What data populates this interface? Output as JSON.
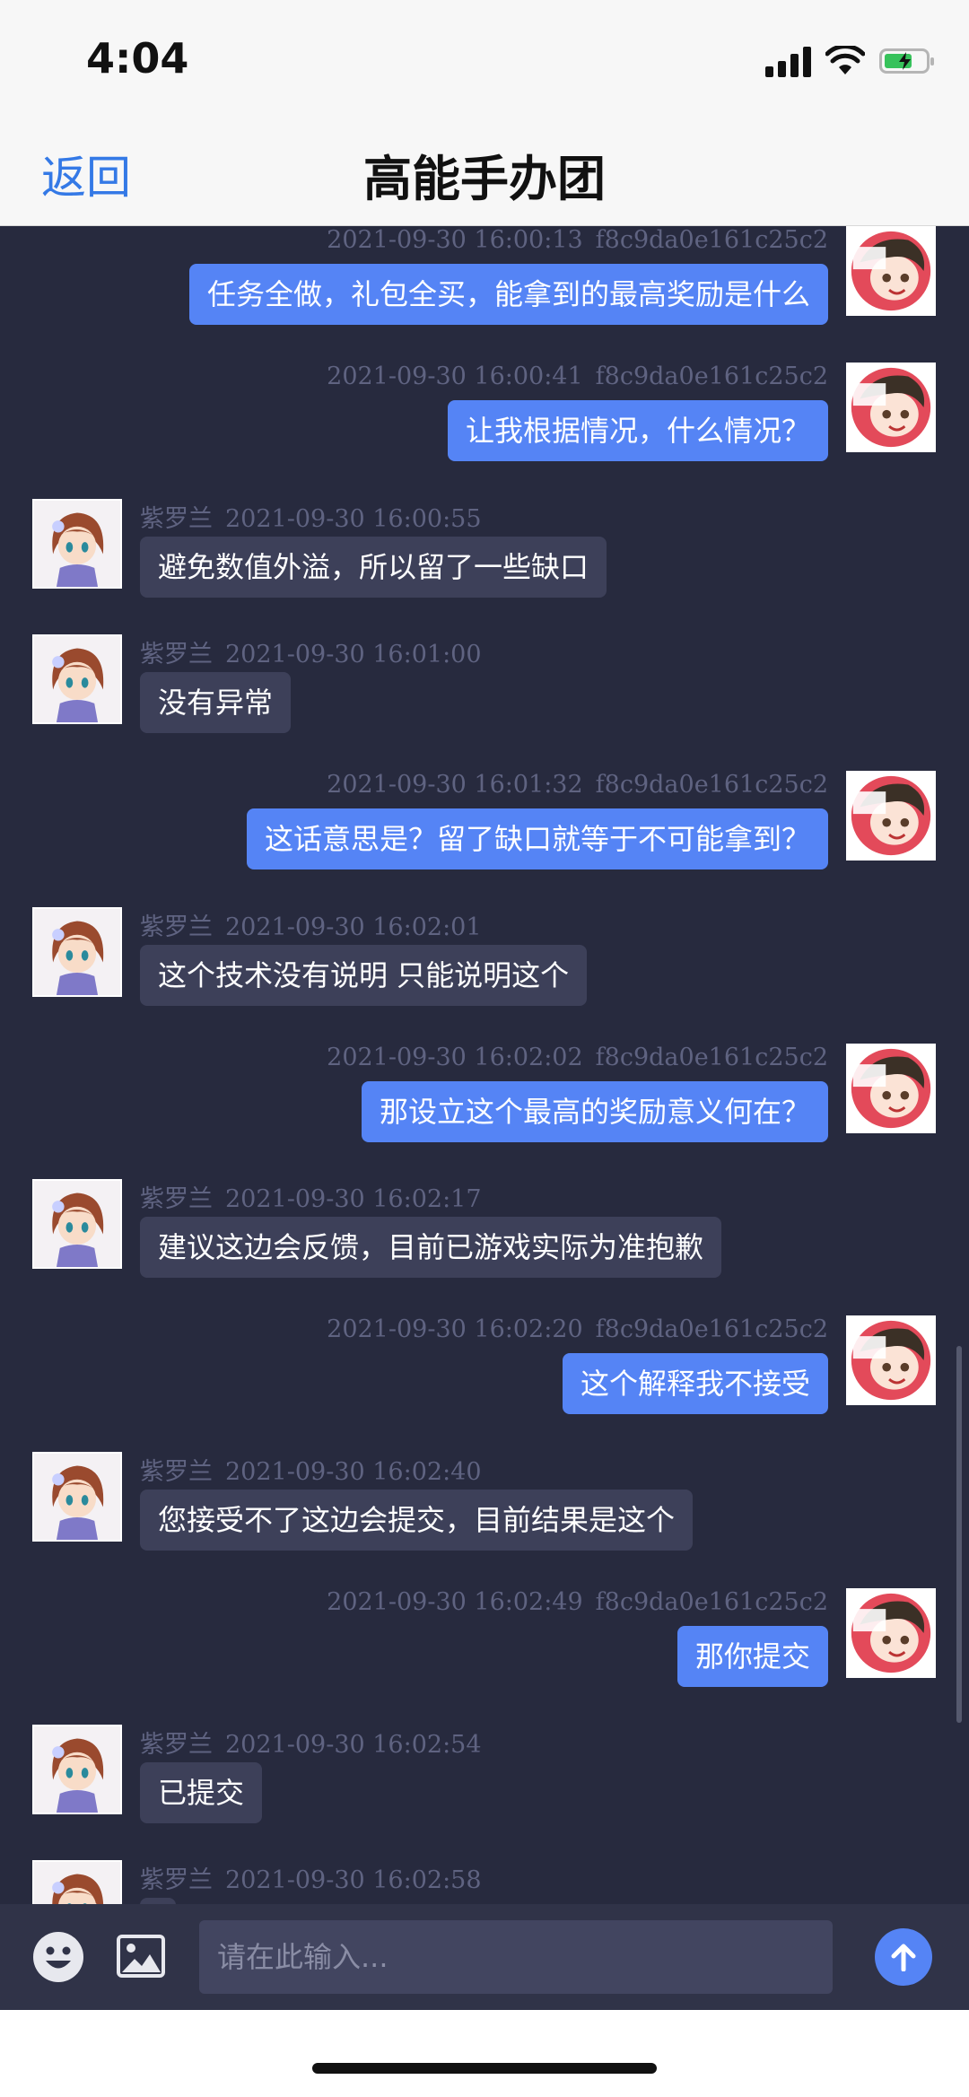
{
  "status_bar": {
    "time": "4:04",
    "battery_color": "#37c25b"
  },
  "nav": {
    "back_label": "返回",
    "title": "高能手办团"
  },
  "colors": {
    "accent": "#5584f5",
    "link": "#3479e6",
    "background": "#272a3e"
  },
  "messages": [
    {
      "side": "right",
      "name": "",
      "timestamp": "2021-09-30 16:00:13",
      "sender_id": "f8c9da0e161c25c2",
      "text": "任务全做，礼包全买，能拿到的最高奖励是什么"
    },
    {
      "side": "right",
      "name": "",
      "timestamp": "2021-09-30 16:00:41",
      "sender_id": "f8c9da0e161c25c2",
      "text": "让我根据情况，什么情况？"
    },
    {
      "side": "left",
      "name": "紫罗兰",
      "timestamp": "2021-09-30 16:00:55",
      "sender_id": "",
      "text": "避免数值外溢，所以留了一些缺口"
    },
    {
      "side": "left",
      "name": "紫罗兰",
      "timestamp": "2021-09-30 16:01:00",
      "sender_id": "",
      "text": "没有异常"
    },
    {
      "side": "right",
      "name": "",
      "timestamp": "2021-09-30 16:01:32",
      "sender_id": "f8c9da0e161c25c2",
      "text": "这话意思是？留了缺口就等于不可能拿到？"
    },
    {
      "side": "left",
      "name": "紫罗兰",
      "timestamp": "2021-09-30 16:02:01",
      "sender_id": "",
      "text": "这个技术没有说明 只能说明这个"
    },
    {
      "side": "right",
      "name": "",
      "timestamp": "2021-09-30 16:02:02",
      "sender_id": "f8c9da0e161c25c2",
      "text": "那设立这个最高的奖励意义何在？"
    },
    {
      "side": "left",
      "name": "紫罗兰",
      "timestamp": "2021-09-30 16:02:17",
      "sender_id": "",
      "text": "建议这边会反馈，目前已游戏实际为准抱歉"
    },
    {
      "side": "right",
      "name": "",
      "timestamp": "2021-09-30 16:02:20",
      "sender_id": "f8c9da0e161c25c2",
      "text": "这个解释我不接受"
    },
    {
      "side": "left",
      "name": "紫罗兰",
      "timestamp": "2021-09-30 16:02:40",
      "sender_id": "",
      "text": "您接受不了这边会提交，目前结果是这个"
    },
    {
      "side": "right",
      "name": "",
      "timestamp": "2021-09-30 16:02:49",
      "sender_id": "f8c9da0e161c25c2",
      "text": "那你提交"
    },
    {
      "side": "left",
      "name": "紫罗兰",
      "timestamp": "2021-09-30 16:02:54",
      "sender_id": "",
      "text": "已提交"
    },
    {
      "side": "left",
      "name": "紫罗兰",
      "timestamp": "2021-09-30 16:02:58",
      "sender_id": "",
      "text": ""
    }
  ],
  "input_bar": {
    "placeholder": "请在此输入...",
    "emoji_icon": "emoji-icon",
    "image_icon": "image-icon",
    "send_icon": "arrow-up-icon"
  }
}
